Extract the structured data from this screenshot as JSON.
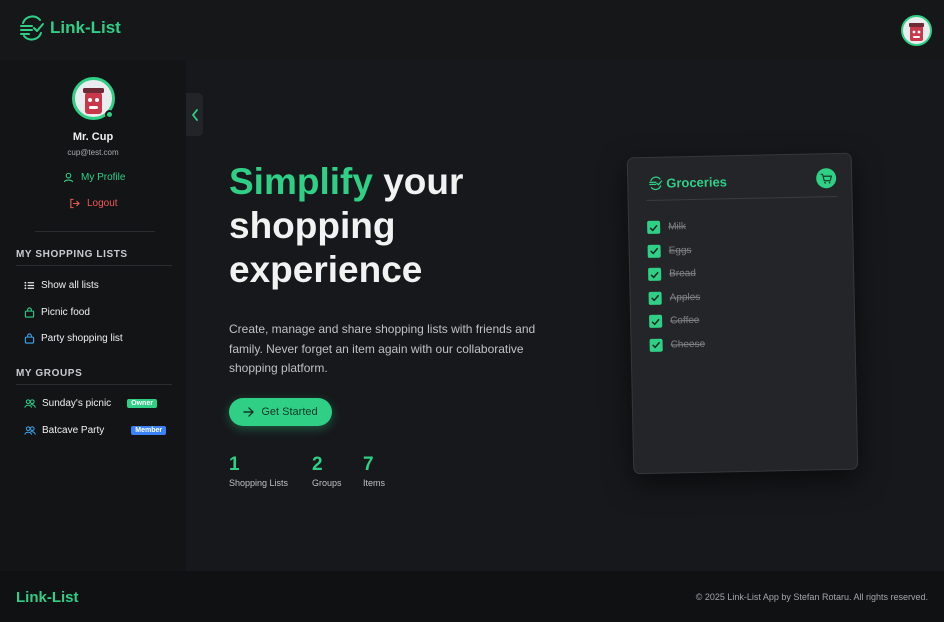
{
  "brand": {
    "name": "Link-List",
    "icon": "list-check-icon"
  },
  "header": {
    "avatar_icon": "avatar-icon"
  },
  "sidebar": {
    "user": {
      "name": "Mr. Cup",
      "email": "cup@test.com"
    },
    "profile_link": "My Profile",
    "logout_link": "Logout",
    "lists_title": "MY SHOPPING LISTS",
    "lists": [
      {
        "label": "Show all lists",
        "icon": "list-icon"
      },
      {
        "label": "Picnic food",
        "icon": "basket-icon"
      },
      {
        "label": "Party shopping list",
        "icon": "basket-icon"
      }
    ],
    "groups_title": "MY GROUPS",
    "groups": [
      {
        "label": "Sunday's picnic",
        "badge": "Owner",
        "badge_color": "#2fcf86",
        "icon": "group-icon"
      },
      {
        "label": "Batcave Party",
        "badge": "Member",
        "badge_color": "#3b82f6",
        "icon": "group-icon"
      }
    ]
  },
  "hero": {
    "title_accent": "Simplify",
    "title_rest": " your shopping experience",
    "description": "Create, manage and share shopping lists with friends and family. Never forget an item again with our collaborative shopping platform.",
    "cta": "Get Started",
    "stats": [
      {
        "value": "1",
        "label": "Shopping Lists"
      },
      {
        "value": "2",
        "label": "Groups"
      },
      {
        "value": "7",
        "label": "Items"
      }
    ]
  },
  "card": {
    "title": "Groceries",
    "items": [
      "Milk",
      "Eggs",
      "Bread",
      "Apples",
      "Coffee",
      "Cheese"
    ]
  },
  "footer": {
    "brand": "Link-List",
    "copyright": "© 2025 Link-List App by Stefan Rotaru. All rights reserved."
  },
  "colors": {
    "accent": "#2fcf86",
    "danger": "#ef5a5a",
    "background": "#17181b"
  }
}
